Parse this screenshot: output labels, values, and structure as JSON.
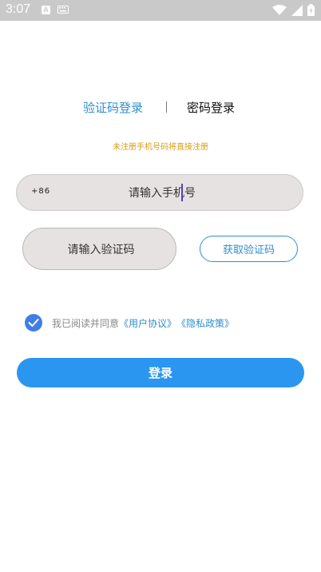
{
  "status_bar": {
    "time": "3:07",
    "icon_a_label": "A",
    "icons": [
      "notification-a-icon",
      "keyboard-icon",
      "wifi-icon",
      "signal-icon",
      "battery-icon"
    ]
  },
  "tabs": {
    "sms_login": "验证码登录",
    "password_login": "密码登录"
  },
  "notice": "未注册手机号码将直接注册",
  "phone": {
    "prefix": "+86",
    "placeholder": "请输入手机号"
  },
  "code": {
    "placeholder": "请输入验证码",
    "get_code_label": "获取验证码"
  },
  "agreement": {
    "text": "我已阅读并同意",
    "user_agreement": "《用户协议》",
    "privacy_policy": "《隐私政策》"
  },
  "login_label": "登录",
  "colors": {
    "accent": "#2f8fd0",
    "button": "#2b96f0",
    "notice": "#d79c13",
    "checkbox": "#3f7ee8"
  }
}
